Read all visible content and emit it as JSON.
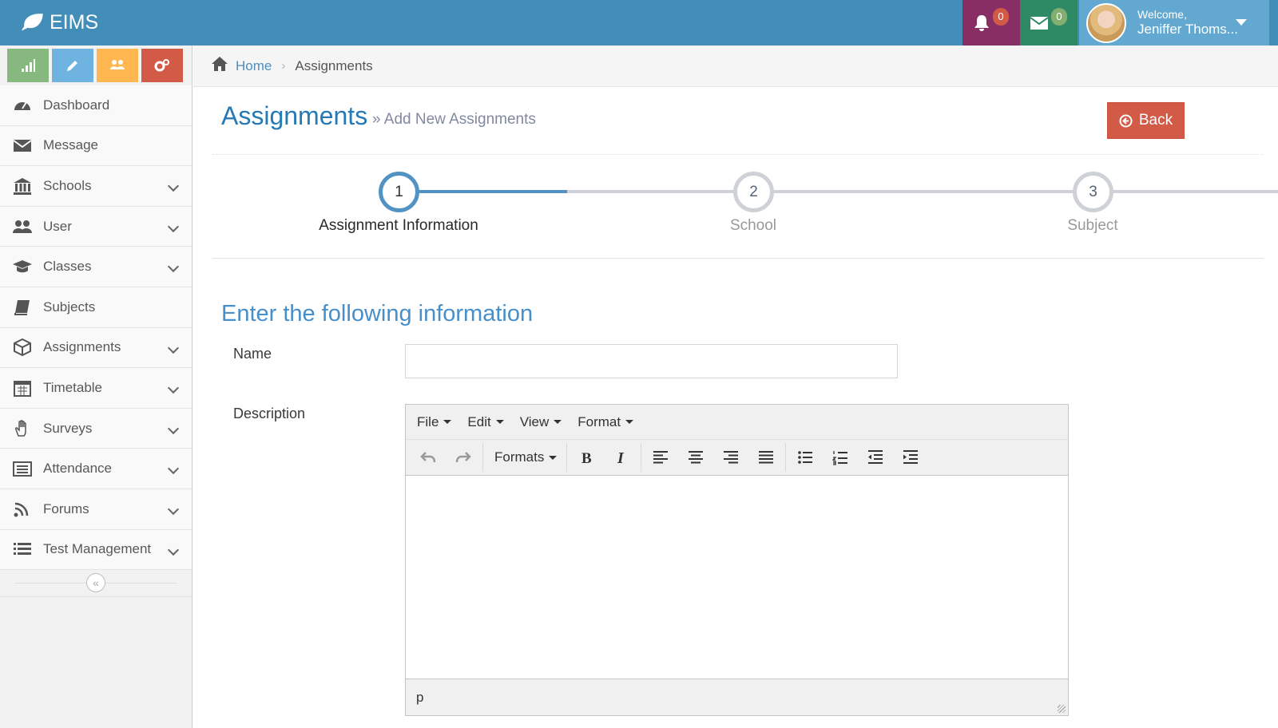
{
  "app": {
    "brand": "EIMS"
  },
  "topbar": {
    "notifications_count": "0",
    "messages_count": "0",
    "user": {
      "welcome": "Welcome,",
      "name": "Jeniffer Thoms..."
    }
  },
  "shortcuts": [
    {
      "icon": "signal-icon",
      "color": "#87b87f"
    },
    {
      "icon": "pencil-icon",
      "color": "#6fb3e0"
    },
    {
      "icon": "users-icon",
      "color": "#ffb752"
    },
    {
      "icon": "cogs-icon",
      "color": "#d15b47"
    }
  ],
  "sidebar": {
    "items": [
      {
        "label": "Dashboard",
        "icon": "tachometer-icon",
        "has_submenu": false
      },
      {
        "label": "Message",
        "icon": "envelope-icon",
        "has_submenu": false
      },
      {
        "label": "Schools",
        "icon": "institution-icon",
        "has_submenu": true
      },
      {
        "label": "User",
        "icon": "users-icon",
        "has_submenu": true
      },
      {
        "label": "Classes",
        "icon": "graduation-cap-icon",
        "has_submenu": true
      },
      {
        "label": "Subjects",
        "icon": "book-icon",
        "has_submenu": false
      },
      {
        "label": "Assignments",
        "icon": "cube-icon",
        "has_submenu": true
      },
      {
        "label": "Timetable",
        "icon": "calendar-icon",
        "has_submenu": true
      },
      {
        "label": "Surveys",
        "icon": "hand-icon",
        "has_submenu": true
      },
      {
        "label": "Attendance",
        "icon": "list-alt-icon",
        "has_submenu": true
      },
      {
        "label": "Forums",
        "icon": "rss-icon",
        "has_submenu": true
      },
      {
        "label": "Test Management",
        "icon": "list-icon",
        "has_submenu": true
      }
    ],
    "collapse_glyph": "«"
  },
  "breadcrumb": {
    "home": "Home",
    "separator": "›",
    "current": "Assignments"
  },
  "page": {
    "title": "Assignments",
    "subtitle": "» Add New Assignments",
    "back_label": "Back"
  },
  "steps": [
    {
      "number": "1",
      "title": "Assignment Information",
      "active": true
    },
    {
      "number": "2",
      "title": "School",
      "active": false
    },
    {
      "number": "3",
      "title": "Subject",
      "active": false
    }
  ],
  "form": {
    "header": "Enter the following information",
    "name_label": "Name",
    "name_value": "",
    "description_label": "Description"
  },
  "editor": {
    "menus": [
      "File",
      "Edit",
      "View",
      "Format"
    ],
    "formats_label": "Formats",
    "status_path": "p"
  },
  "colors": {
    "navbar": "#438eb9",
    "accent": "#2679b5",
    "step_active": "#5293c4",
    "danger": "#d15b47"
  }
}
